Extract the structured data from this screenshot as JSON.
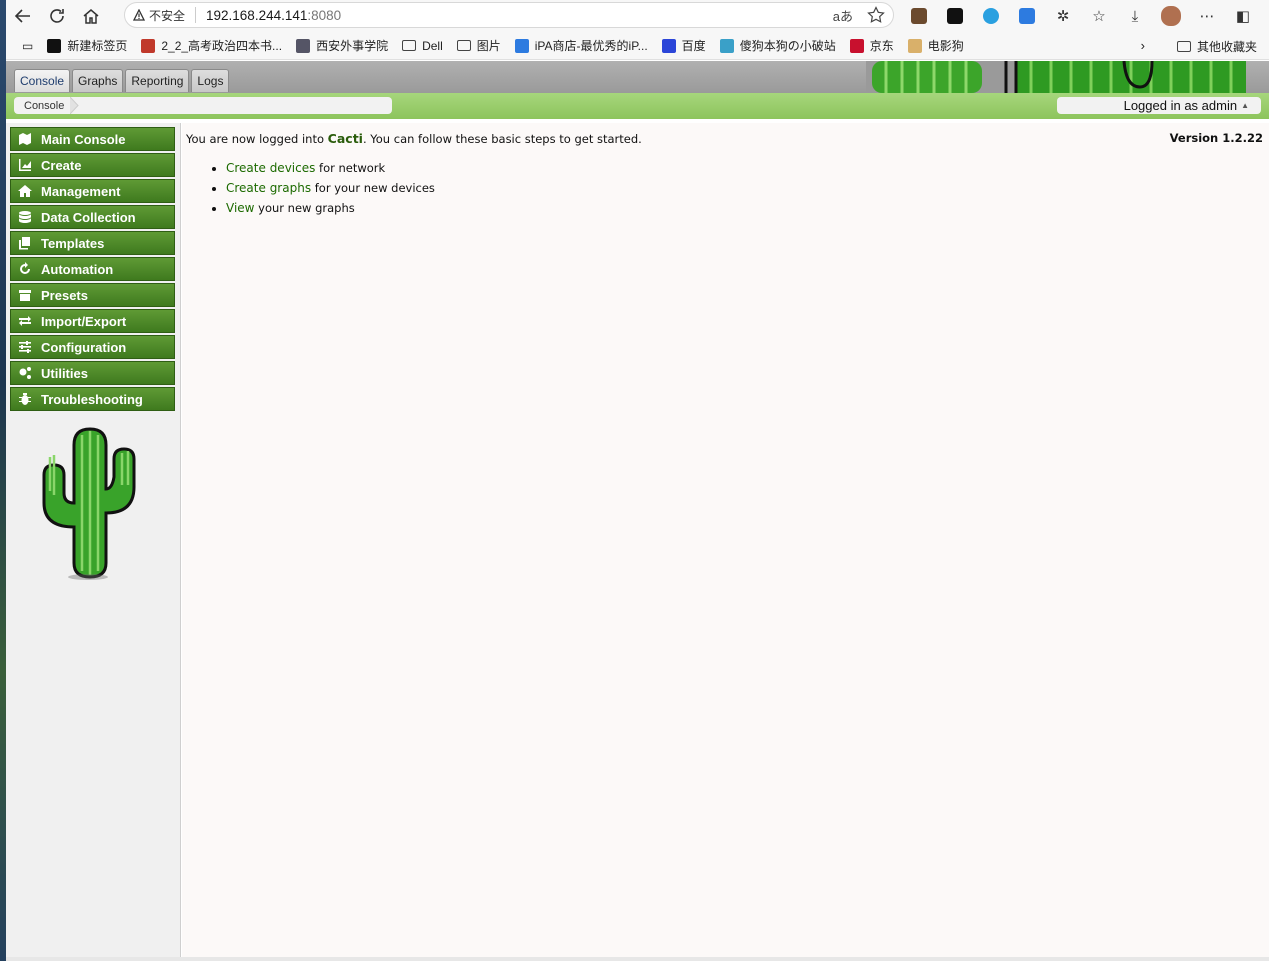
{
  "browser": {
    "security_label": "不安全",
    "url_host": "192.168.244.141",
    "url_port": ":8080",
    "read_aloud_label": "aあ",
    "bookmarks": [
      {
        "label": "新建标签页",
        "color": "#111111"
      },
      {
        "label": "2_2_高考政治四本书...",
        "color": "#c0392b"
      },
      {
        "label": "西安外事学院",
        "color": "#555566"
      },
      {
        "label": "Dell",
        "color": "folder"
      },
      {
        "label": "图片",
        "color": "folder"
      },
      {
        "label": "iPA商店-最优秀的iP...",
        "color": "#2d7be0"
      },
      {
        "label": "百度",
        "color": "#2b45d8"
      },
      {
        "label": "傻狗本狗の小破站",
        "color": "#3aa0c8"
      },
      {
        "label": "京东",
        "color": "#c8102e"
      },
      {
        "label": "电影狗",
        "color": "#d9b06a"
      }
    ],
    "other_bookmarks": "其他收藏夹"
  },
  "cacti": {
    "tabs": [
      "Console",
      "Graphs",
      "Reporting",
      "Logs"
    ],
    "active_tab": "Console",
    "breadcrumb": "Console",
    "user_label": "Logged in as admin",
    "user_caret": "▲",
    "menu": [
      {
        "label": "Main Console",
        "icon": "map-icon"
      },
      {
        "label": "Create",
        "icon": "chart-icon"
      },
      {
        "label": "Management",
        "icon": "home-icon"
      },
      {
        "label": "Data Collection",
        "icon": "database-icon"
      },
      {
        "label": "Templates",
        "icon": "copy-icon"
      },
      {
        "label": "Automation",
        "icon": "refresh-icon"
      },
      {
        "label": "Presets",
        "icon": "archive-icon"
      },
      {
        "label": "Import/Export",
        "icon": "exchange-icon"
      },
      {
        "label": "Configuration",
        "icon": "sliders-icon"
      },
      {
        "label": "Utilities",
        "icon": "cogs-icon"
      },
      {
        "label": "Troubleshooting",
        "icon": "bug-icon"
      }
    ],
    "welcome_prefix": "You are now logged into ",
    "welcome_brand": "Cacti",
    "welcome_suffix": ". You can follow these basic steps to get started.",
    "version": "Version 1.2.22",
    "steps": [
      {
        "link": "Create devices",
        "text": " for network"
      },
      {
        "link": "Create graphs",
        "text": " for your new devices"
      },
      {
        "link": "View",
        "text": " your new graphs"
      }
    ],
    "accent_color": "#4e8a28"
  }
}
